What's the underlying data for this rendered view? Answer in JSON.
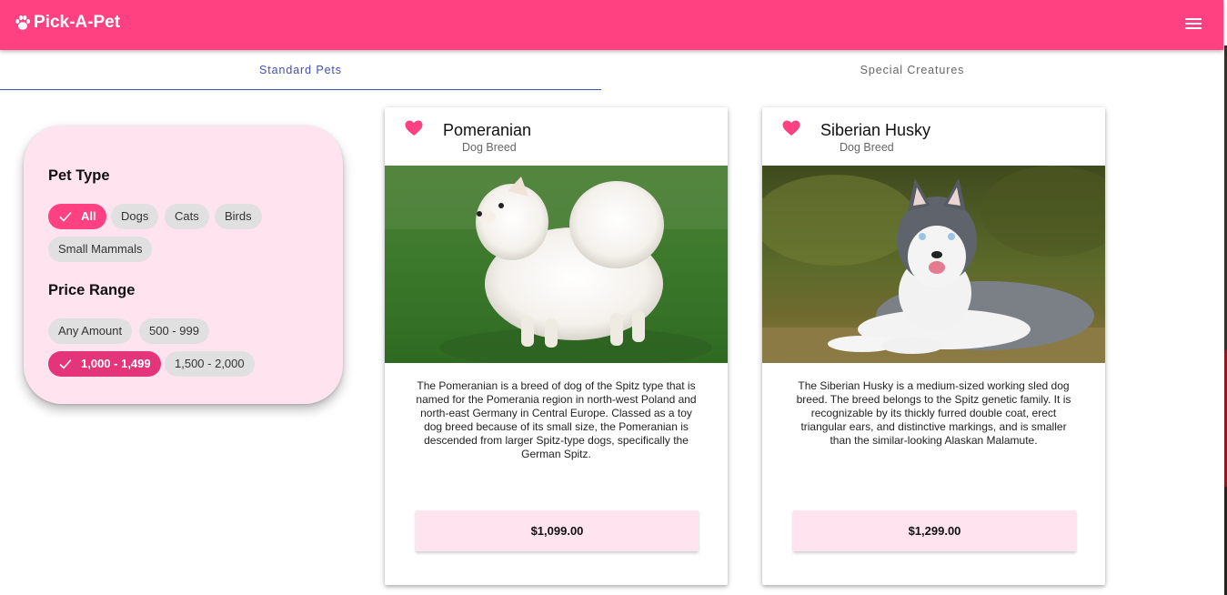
{
  "app": {
    "title": "Pick-A-Pet"
  },
  "tabs": [
    {
      "label": "Standard Pets",
      "active": true
    },
    {
      "label": "Special Creatures",
      "active": false
    }
  ],
  "filters": {
    "pet_type": {
      "title": "Pet Type",
      "options": [
        "All",
        "Dogs",
        "Cats",
        "Birds",
        "Small Mammals"
      ],
      "selected": "All"
    },
    "price_range": {
      "title": "Price Range",
      "options": [
        "Any Amount",
        "500 - 999",
        "1,000 - 1,499",
        "1,500 - 2,000"
      ],
      "selected": "1,000 - 1,499"
    }
  },
  "pets": [
    {
      "name": "Pomeranian",
      "category": "Dog Breed",
      "description": "The Pomeranian is a breed of dog of the Spitz type that is named for the Pomerania region in north-west Poland and north-east Germany in Central Europe. Classed as a toy dog breed because of its small size, the Pomeranian is descended from larger Spitz-type dogs, specifically the German Spitz.",
      "price": "$1,099.00",
      "favorited": true
    },
    {
      "name": "Siberian Husky",
      "category": "Dog Breed",
      "description": "The Siberian Husky is a medium-sized working sled dog breed. The breed belongs to the Spitz genetic family. It is recognizable by its thickly furred double coat, erect triangular ears, and distinctive markings, and is smaller than the similar-looking Alaskan Malamute.",
      "price": "$1,299.00",
      "favorited": true
    }
  ],
  "colors": {
    "brand": "#ff4081",
    "tab_active": "#3f51b5",
    "filter_panel": "#ffe4f0",
    "chip": "#e0e0e0"
  },
  "icons": {
    "logo": "paw-icon",
    "menu": "hamburger-menu-icon",
    "favorite": "heart-icon",
    "selected_chip": "check-icon"
  }
}
